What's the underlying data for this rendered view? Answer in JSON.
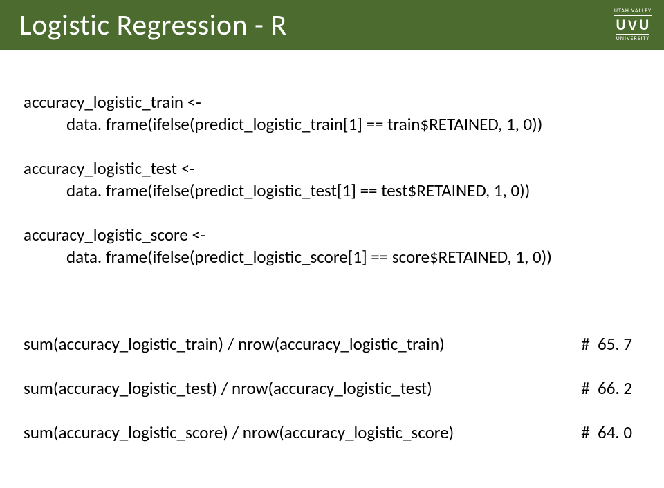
{
  "header": {
    "title": "Logistic Regression - R",
    "logo_top": "UTAH VALLEY",
    "logo_mid": "UVU",
    "logo_bot": "UNIVERSITY"
  },
  "code": {
    "l1": "accuracy_logistic_train <-",
    "l2": "data. frame(ifelse(predict_logistic_train[1] == train$RETAINED, 1, 0))",
    "l3": "accuracy_logistic_test <-",
    "l4": "data. frame(ifelse(predict_logistic_test[1] == test$RETAINED, 1, 0))",
    "l5": "accuracy_logistic_score <-",
    "l6": "data. frame(ifelse(predict_logistic_score[1] == score$RETAINED, 1, 0))",
    "r1_left": "sum(accuracy_logistic_train) / nrow(accuracy_logistic_train)",
    "r1_right": "#  65. 7",
    "r2_left": "sum(accuracy_logistic_test) / nrow(accuracy_logistic_test)",
    "r2_right": "#  66. 2",
    "r3_left": "sum(accuracy_logistic_score) / nrow(accuracy_logistic_score)",
    "r3_right": "#  64. 0"
  }
}
